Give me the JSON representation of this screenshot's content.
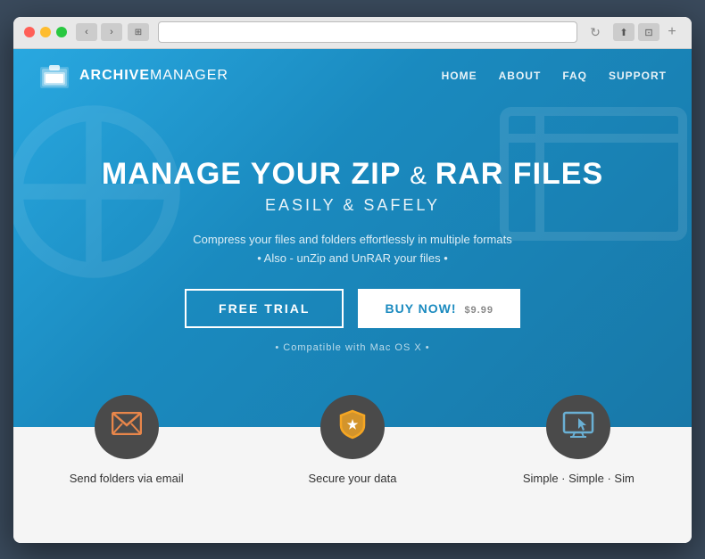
{
  "window": {
    "title": "ArchiveManager"
  },
  "navbar": {
    "logo_bold": "ARCHIVE",
    "logo_light": "MANAGER",
    "links": [
      "HOME",
      "ABOUT",
      "FAQ",
      "SUPPORT"
    ]
  },
  "hero": {
    "title_line1": "MANAGE YOUR ZIP",
    "title_ampersand": "&",
    "title_line2": "RAR FILES",
    "subtitle": "EASILY & SAFELY",
    "desc_line1": "Compress your files and folders effortlessly in multiple formats",
    "desc_line2": "• Also - unZip and UnRAR your files •",
    "btn_free": "FREE TRIAL",
    "btn_buy": "BUY NOW!",
    "btn_price": "$9.99",
    "compat": "• Compatible with Mac OS X •"
  },
  "features": [
    {
      "icon": "✉",
      "label": "Send folders via email",
      "icon_color": "#e8864a"
    },
    {
      "icon": "★",
      "label": "Secure your data",
      "icon_color": "#f5a623"
    },
    {
      "icon": "⊡",
      "label": "Simple · Simple · Sim",
      "icon_color": "#6ab0d4"
    }
  ],
  "colors": {
    "hero_bg_start": "#29a8e0",
    "hero_bg_end": "#1878a8",
    "feature_circle": "#4a4a4a",
    "feature_bg": "#f5f5f5"
  }
}
